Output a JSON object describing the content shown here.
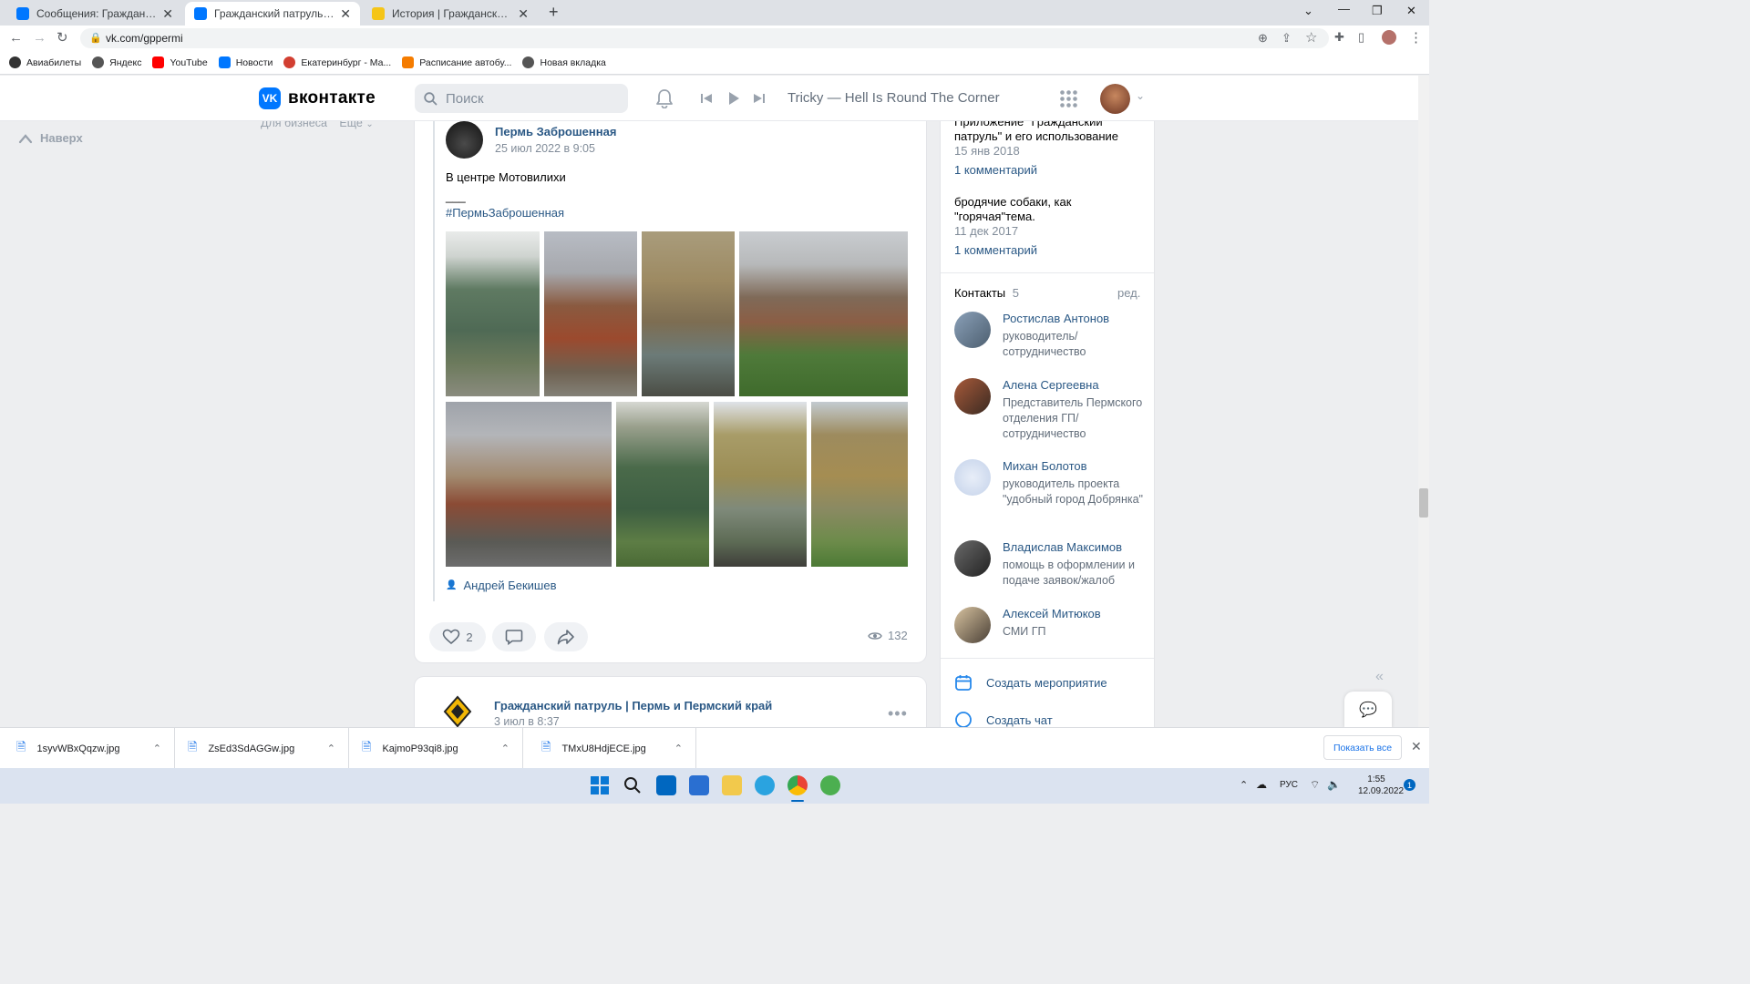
{
  "browser": {
    "tabs": [
      {
        "title": "Сообщения: Гражданский патр",
        "active": false
      },
      {
        "title": "Гражданский патруль | Пермь и",
        "active": true
      },
      {
        "title": "История | Гражданский патруль",
        "active": false
      }
    ],
    "url": "vk.com/gppermi",
    "bookmarks": [
      "Авиабилеты",
      "Яндекс",
      "YouTube",
      "Новости",
      "Екатеринбург - Ма...",
      "Расписание автобу...",
      "Новая вкладка"
    ]
  },
  "vk": {
    "logo": "вконтакте",
    "search_placeholder": "Поиск",
    "now_playing": "Tricky — Hell Is Round The Corner",
    "back_to_top": "Наверх",
    "left_links": {
      "business": "Для бизнеса",
      "more": "Еще"
    }
  },
  "post": {
    "author": "Пермь Заброшенная",
    "date": "25 июл 2022 в 9:05",
    "text": "В центре Мотовилихи",
    "separator": "___",
    "hashtag": "#ПермьЗаброшенная",
    "signer": "Андрей Бекишев",
    "likes": "2",
    "views": "132"
  },
  "post2": {
    "author": "Гражданский патруль | Пермь и Пермский край",
    "date": "3 июл в 8:37"
  },
  "sidebar": {
    "topics": [
      {
        "title_line1": "Приложение \"Гражданский",
        "title_line2": "патруль\" и его использование",
        "date": "15 янв 2018",
        "comments": "1 комментарий"
      },
      {
        "title_line1": "бродячие собаки, как",
        "title_line2": "\"горячая\"тема.",
        "date": "11 дек 2017",
        "comments": "1 комментарий"
      }
    ],
    "contacts_title": "Контакты",
    "contacts_count": "5",
    "edit_label": "ред.",
    "contacts": [
      {
        "name": "Ростислав Антонов",
        "role": "руководитель/ сотрудничество"
      },
      {
        "name": "Алена Сергеевна",
        "role": "Представитель Пермского отделения ГП/сотрудничество"
      },
      {
        "name": "Михан Болотов",
        "role": "руководитель проекта \"удобный город Добрянка\""
      },
      {
        "name": "Владислав Максимов",
        "role": "помощь в оформлении и подаче заявок/жалоб"
      },
      {
        "name": "Алексей Митюков",
        "role": "СМИ ГП"
      }
    ],
    "create_event": "Создать мероприятие",
    "create_chat": "Создать чат"
  },
  "downloads": {
    "files": [
      "1syvWBxQqzw.jpg",
      "ZsEd3SdAGGw.jpg",
      "KajmoP93qi8.jpg",
      "TMxU8HdjECE.jpg"
    ],
    "show_all": "Показать все"
  },
  "taskbar": {
    "lang": "РУС",
    "time": "1:55",
    "date": "12.09.2022",
    "notifications": "1"
  }
}
